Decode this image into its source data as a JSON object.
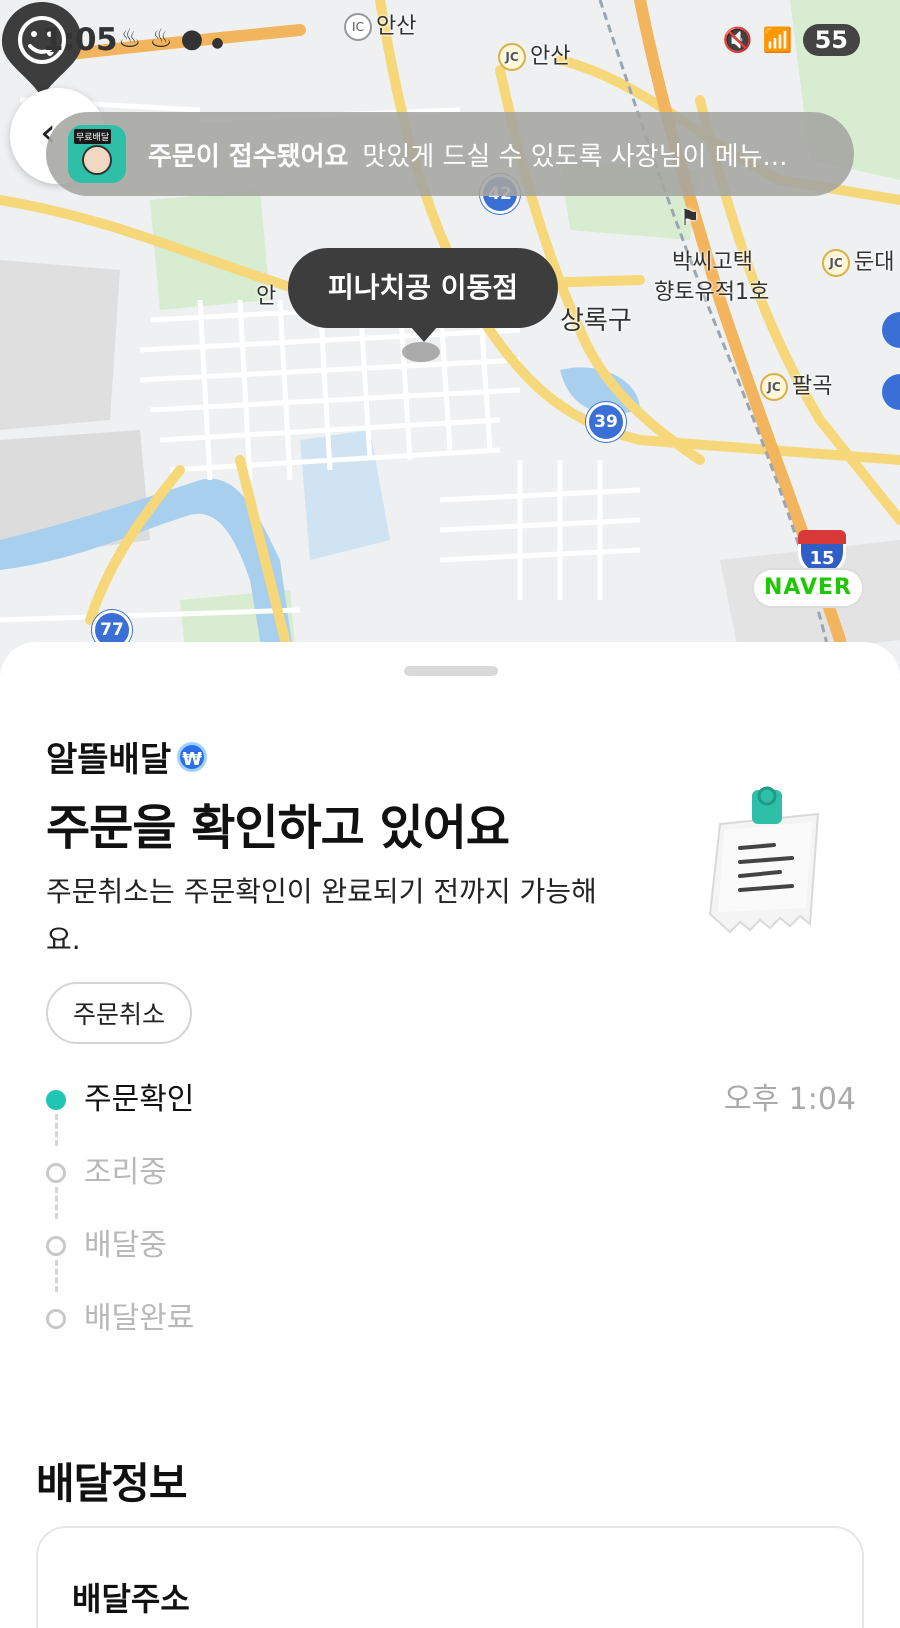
{
  "status_bar": {
    "time": "1:05",
    "battery": "55"
  },
  "map": {
    "labels": {
      "ic_ansan": "안산",
      "jc_ansan": "안산",
      "dundae": "둔대",
      "palgok": "팔곡",
      "museum_line1": "박씨고택",
      "museum_line2": "향토유적1호",
      "district": "상록구",
      "an_partial": "안"
    },
    "badges": {
      "ic": "IC",
      "jc": "JC"
    },
    "route_numbers": [
      "42",
      "39",
      "77"
    ],
    "highway_number": "15",
    "naver": "NAVER",
    "store_name": "피나치공 이동점"
  },
  "notification": {
    "app_tag": "무료배달",
    "title": "주문이 접수됐어요",
    "body": "맛있게 드실 수 있도록 사장님이 메뉴..."
  },
  "order": {
    "brand": "알뜰배달",
    "brand_badge": "₩",
    "headline": "주문을 확인하고 있어요",
    "description": "주문취소는 주문확인이 완료되기 전까지 가능해요.",
    "cancel_label": "주문취소",
    "steps": [
      {
        "label": "주문확인",
        "time": "오후 1:04",
        "active": true
      },
      {
        "label": "조리중",
        "time": "",
        "active": false
      },
      {
        "label": "배달중",
        "time": "",
        "active": false
      },
      {
        "label": "배달완료",
        "time": "",
        "active": false
      }
    ]
  },
  "delivery_info": {
    "section_title": "배달정보",
    "card_title": "배달주소"
  },
  "colors": {
    "accent": "#1fc6b4",
    "notification_bg": "#a5a5a0",
    "bubble": "#3d3d3d",
    "naver_green": "#1ec800"
  }
}
